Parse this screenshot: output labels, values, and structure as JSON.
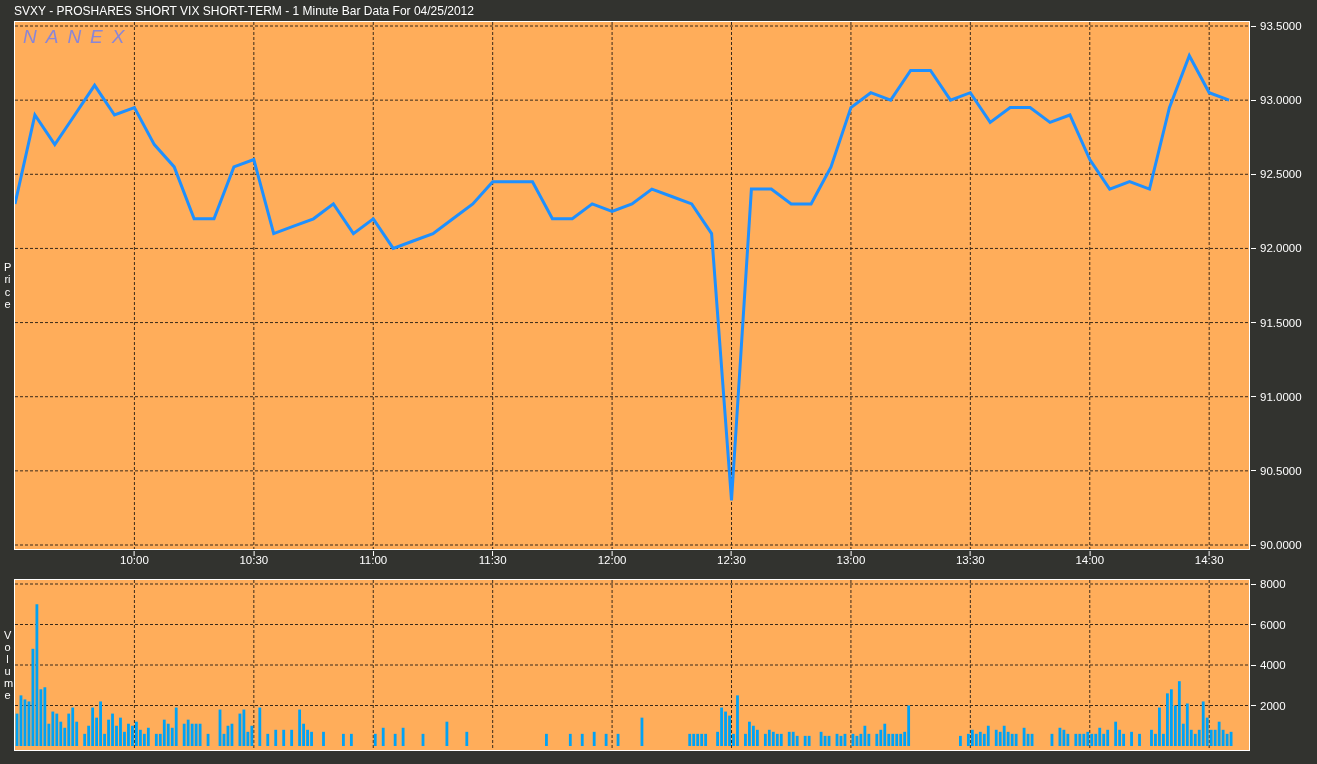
{
  "window": {
    "title": "SVXY - PROSHARES SHORT VIX SHORT-TERM - 1 Minute Bar Data For 04/25/2012"
  },
  "price_panel": {
    "logo": "NANEX",
    "chart_data": {
      "type": "line",
      "ylabel": "Price",
      "grid": true,
      "xlim": [
        9.5,
        14.6667
      ],
      "ylim": [
        90,
        93.5
      ],
      "xticks": [
        {
          "value": 10,
          "label": "10:00"
        },
        {
          "value": 10.5,
          "label": "10:30"
        },
        {
          "value": 11,
          "label": "11:00"
        },
        {
          "value": 11.5,
          "label": "11:30"
        },
        {
          "value": 12,
          "label": "12:00"
        },
        {
          "value": 12.5,
          "label": "12:30"
        },
        {
          "value": 13,
          "label": "13:00"
        },
        {
          "value": 13.5,
          "label": "13:30"
        },
        {
          "value": 14,
          "label": "14:00"
        },
        {
          "value": 14.5,
          "label": "14:30"
        }
      ],
      "yticks": [
        {
          "value": 90,
          "label": "90.0000"
        },
        {
          "value": 90.5,
          "label": "90.5000"
        },
        {
          "value": 91,
          "label": "91.0000"
        },
        {
          "value": 91.5,
          "label": "91.5000"
        },
        {
          "value": 92,
          "label": "92.0000"
        },
        {
          "value": 92.5,
          "label": "92.5000"
        },
        {
          "value": 93,
          "label": "93.0000"
        },
        {
          "value": 93.5,
          "label": "93.5000"
        }
      ],
      "x": [
        9.5,
        9.5833,
        9.6667,
        9.75,
        9.8333,
        9.9167,
        10,
        10.0833,
        10.1667,
        10.25,
        10.3333,
        10.4167,
        10.5,
        10.5833,
        10.6667,
        10.75,
        10.8333,
        10.9167,
        11,
        11.0833,
        11.1667,
        11.25,
        11.3333,
        11.4167,
        11.5,
        11.5833,
        11.6667,
        11.75,
        11.8333,
        11.9167,
        12,
        12.0833,
        12.1667,
        12.25,
        12.3333,
        12.4167,
        12.5,
        12.5833,
        12.6667,
        12.75,
        12.8333,
        12.9167,
        13,
        13.0833,
        13.1667,
        13.25,
        13.3333,
        13.4167,
        13.5,
        13.5833,
        13.6667,
        13.75,
        13.8333,
        13.9167,
        14,
        14.0833,
        14.1667,
        14.25,
        14.3333,
        14.4167,
        14.5,
        14.5833
      ],
      "series": [
        {
          "color": "#1e90ff",
          "values": [
            92.3,
            92.9,
            92.7,
            92.9,
            93.1,
            92.9,
            92.95,
            92.7,
            92.55,
            92.2,
            92.2,
            92.55,
            92.6,
            92.1,
            92.15,
            92.2,
            92.3,
            92.1,
            92.2,
            92.0,
            92.05,
            92.1,
            92.2,
            92.3,
            92.45,
            92.45,
            92.45,
            92.2,
            92.2,
            92.3,
            92.25,
            92.3,
            92.4,
            92.35,
            92.3,
            92.1,
            90.3,
            92.4,
            92.4,
            92.3,
            92.3,
            92.55,
            92.95,
            93.05,
            93.0,
            93.2,
            93.2,
            93.0,
            93.05,
            92.85,
            92.95,
            92.95,
            92.85,
            92.9,
            92.6,
            92.4,
            92.45,
            92.4,
            92.95,
            93.3,
            93.05,
            93.0
          ]
        }
      ]
    }
  },
  "volume_panel": {
    "chart_data": {
      "type": "bar",
      "ylabel": "Volume",
      "grid": true,
      "ylim": [
        0,
        8000
      ],
      "yticks": [
        2000,
        4000,
        6000,
        8000
      ],
      "series": [
        {
          "color": "#00a2f5",
          "values": [
            1600,
            2500,
            2300,
            2200,
            4800,
            7000,
            2800,
            2900,
            1100,
            1700,
            1600,
            1200,
            900,
            1600,
            1900,
            1200,
            null,
            600,
            1000,
            1900,
            1400,
            2200,
            600,
            1300,
            1600,
            1000,
            1400,
            700,
            1100,
            1000,
            1200,
            800,
            600,
            900,
            null,
            600,
            600,
            1300,
            1100,
            900,
            1900,
            null,
            1100,
            1300,
            1100,
            1100,
            1100,
            null,
            600,
            null,
            null,
            1800,
            600,
            1000,
            1100,
            null,
            1600,
            1800,
            700,
            1000,
            null,
            1900,
            null,
            600,
            null,
            800,
            null,
            800,
            null,
            800,
            null,
            1800,
            1100,
            800,
            700,
            null,
            null,
            700,
            null,
            null,
            null,
            null,
            600,
            null,
            600,
            null,
            null,
            null,
            null,
            null,
            600,
            null,
            900,
            null,
            null,
            600,
            null,
            900,
            null,
            null,
            null,
            null,
            600,
            null,
            null,
            null,
            null,
            null,
            1200,
            null,
            null,
            null,
            null,
            700,
            null,
            null,
            null,
            null,
            null,
            null,
            null,
            null,
            null,
            null,
            null,
            null,
            null,
            null,
            null,
            null,
            null,
            null,
            null,
            600,
            null,
            null,
            null,
            null,
            null,
            600,
            null,
            null,
            600,
            null,
            null,
            700,
            null,
            null,
            600,
            null,
            null,
            600,
            null,
            null,
            null,
            null,
            null,
            1400,
            null,
            null,
            null,
            null,
            null,
            null,
            null,
            null,
            null,
            null,
            null,
            600,
            600,
            600,
            600,
            600,
            null,
            null,
            700,
            1900,
            1700,
            1500,
            600,
            2500,
            null,
            600,
            1200,
            1000,
            800,
            null,
            600,
            800,
            700,
            600,
            600,
            null,
            700,
            700,
            500,
            null,
            500,
            500,
            null,
            null,
            700,
            500,
            500,
            null,
            600,
            500,
            600,
            null,
            600,
            500,
            600,
            1000,
            600,
            null,
            600,
            800,
            1100,
            600,
            600,
            600,
            600,
            700,
            2000,
            null,
            null,
            null,
            null,
            null,
            null,
            null,
            null,
            null,
            null,
            null,
            null,
            500,
            null,
            600,
            800,
            600,
            700,
            600,
            1000,
            null,
            800,
            700,
            1000,
            700,
            600,
            600,
            null,
            900,
            600,
            600,
            null,
            null,
            null,
            null,
            600,
            null,
            900,
            800,
            600,
            null,
            600,
            600,
            600,
            700,
            600,
            600,
            900,
            600,
            800,
            null,
            1200,
            800,
            600,
            null,
            700,
            null,
            600,
            null,
            null,
            800,
            600,
            1900,
            600,
            2600,
            2800,
            2000,
            3200,
            1100,
            2100,
            800,
            600,
            800,
            2200,
            1400,
            800,
            800,
            1200,
            800,
            600,
            700,
            null,
            null,
            null,
            null
          ]
        }
      ]
    }
  }
}
